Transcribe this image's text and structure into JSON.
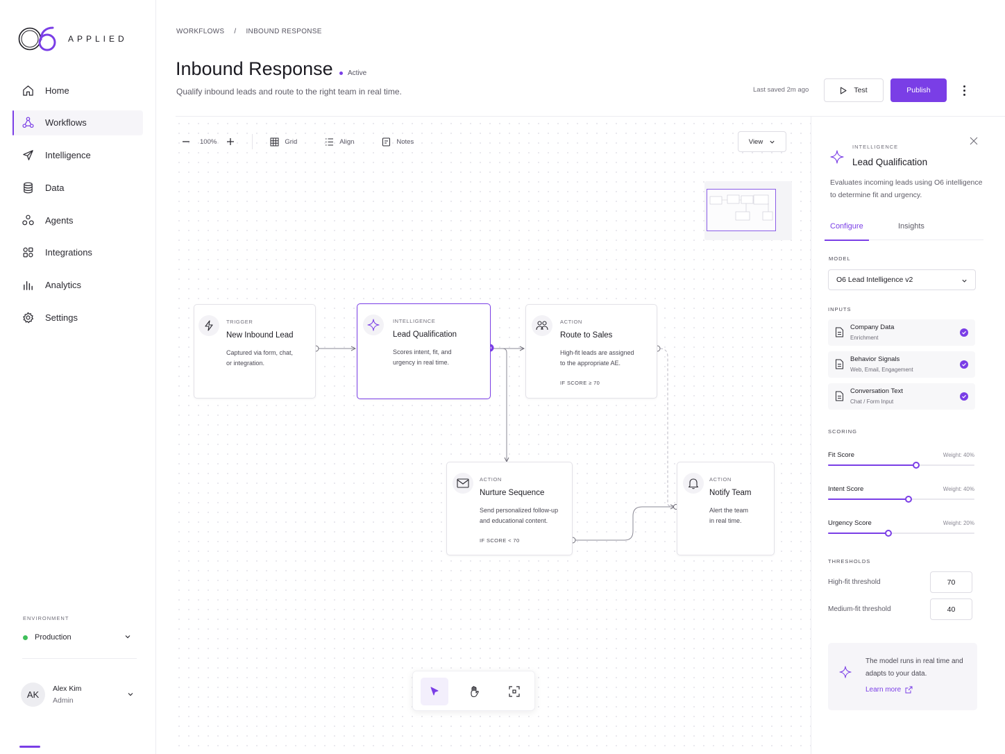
{
  "brand": {
    "wordmark": "APPLIED",
    "accent": "#7a3ee6"
  },
  "sidebar": {
    "items": [
      {
        "label": "Home",
        "icon": "home-icon",
        "active": false
      },
      {
        "label": "Workflows",
        "icon": "workflow-icon",
        "active": true
      },
      {
        "label": "Intelligence",
        "icon": "rocket-icon",
        "active": false
      },
      {
        "label": "Data",
        "icon": "database-icon",
        "active": false
      },
      {
        "label": "Agents",
        "icon": "agents-icon",
        "active": false
      },
      {
        "label": "Integrations",
        "icon": "integrations-icon",
        "active": false
      },
      {
        "label": "Analytics",
        "icon": "analytics-icon",
        "active": false
      },
      {
        "label": "Settings",
        "icon": "gear-icon",
        "active": false
      }
    ],
    "environment": {
      "label": "ENVIRONMENT",
      "value": "Production",
      "status_color": "#3fbf5a"
    },
    "user": {
      "initials": "AK",
      "name": "Alex Kim",
      "role": "Admin"
    }
  },
  "header": {
    "breadcrumb": [
      "WORKFLOWS",
      "/",
      "INBOUND RESPONSE"
    ],
    "title": "Inbound Response",
    "status": "Active",
    "subtitle": "Qualify inbound leads and route to the right team in real time.",
    "last_saved": "Last saved 2m ago",
    "test_label": "Test",
    "publish_label": "Publish"
  },
  "toolbar": {
    "zoom": "100%",
    "grid_label": "Grid",
    "align_label": "Align",
    "notes_label": "Notes",
    "view_label": "View"
  },
  "nodes": {
    "trigger": {
      "kind": "TRIGGER",
      "title": "New Inbound Lead",
      "desc": [
        "Captured via form, chat,",
        "or integration."
      ]
    },
    "qualify": {
      "kind": "INTELLIGENCE",
      "title": "Lead Qualification",
      "desc": [
        "Scores intent, fit, and",
        "urgency in real time."
      ]
    },
    "route": {
      "kind": "ACTION",
      "title": "Route to Sales",
      "desc": [
        "High-fit leads are assigned",
        "to the appropriate AE."
      ],
      "condition": "IF SCORE ≥ 70"
    },
    "nurture": {
      "kind": "ACTION",
      "title": "Nurture Sequence",
      "desc": [
        "Send personalized follow-up",
        "and educational content."
      ],
      "condition": "IF SCORE < 70"
    },
    "notify": {
      "kind": "ACTION",
      "title": "Notify Team",
      "desc": [
        "Alert the team",
        "in real time."
      ]
    }
  },
  "panel": {
    "kind": "INTELLIGENCE",
    "title": "Lead Qualification",
    "description": "Evaluates incoming leads using O6 intelligence to determine fit and urgency.",
    "tabs": [
      "Configure",
      "Insights"
    ],
    "model_label": "MODEL",
    "model_value": "O6 Lead Intelligence v2",
    "inputs_label": "INPUTS",
    "inputs": [
      {
        "name": "Company Data",
        "sub": "Enrichment",
        "checked": true
      },
      {
        "name": "Behavior Signals",
        "sub": "Web, Email, Engagement",
        "checked": true
      },
      {
        "name": "Conversation Text",
        "sub": "Chat / Form Input",
        "checked": true
      }
    ],
    "scoring_label": "SCORING",
    "scores": [
      {
        "name": "Fit Score",
        "weight": "Weight: 40%",
        "level": 0.6
      },
      {
        "name": "Intent Score",
        "weight": "Weight: 40%",
        "level": 0.55
      },
      {
        "name": "Urgency Score",
        "weight": "Weight: 20%",
        "level": 0.41
      }
    ],
    "thresholds_label": "THRESHOLDS",
    "thresholds": [
      {
        "name": "High-fit threshold",
        "value": "70"
      },
      {
        "name": "Medium-fit threshold",
        "value": "40"
      }
    ],
    "info_text": "The model runs in real time and adapts to your data.",
    "info_link": "Learn more"
  }
}
